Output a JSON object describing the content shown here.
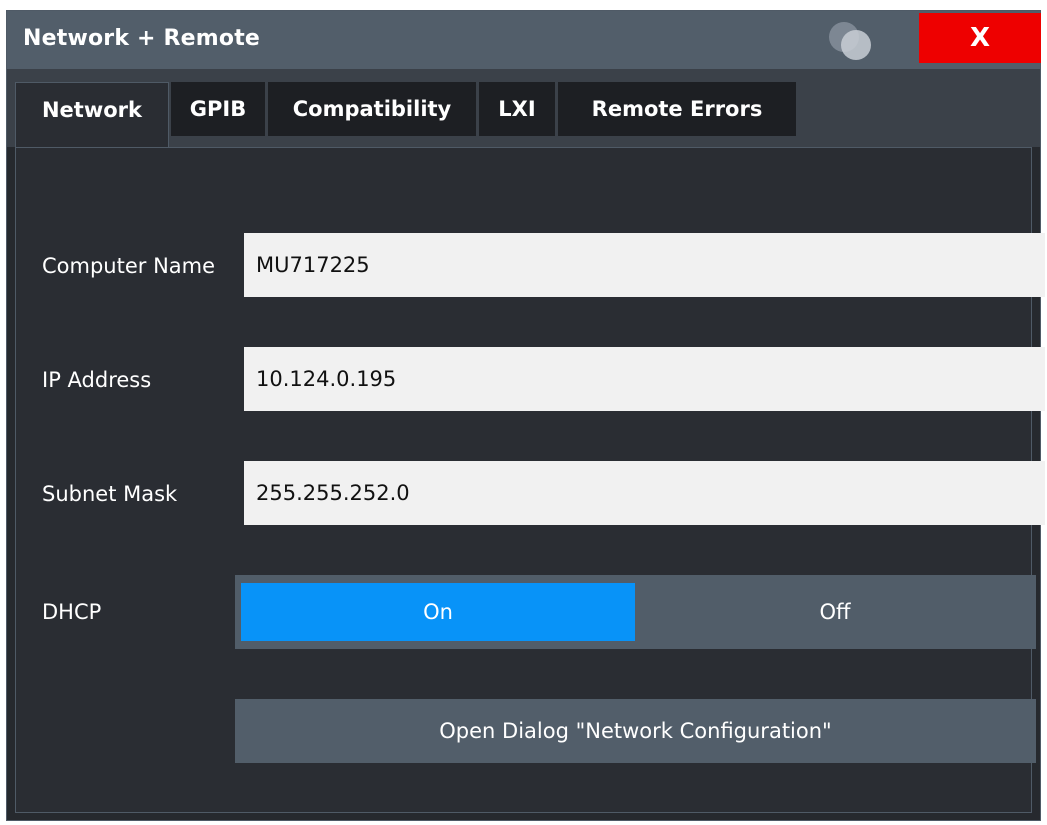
{
  "window": {
    "title": "Network + Remote",
    "close_label": "X"
  },
  "tabs": [
    {
      "label": "Network",
      "active": true
    },
    {
      "label": "GPIB",
      "active": false
    },
    {
      "label": "Compatibility",
      "active": false
    },
    {
      "label": "LXI",
      "active": false
    },
    {
      "label": "Remote Errors",
      "active": false
    }
  ],
  "network": {
    "computer_name": {
      "label": "Computer Name",
      "value": "MU717225"
    },
    "ip_address": {
      "label": "IP Address",
      "value": "10.124.0.195"
    },
    "subnet_mask": {
      "label": "Subnet Mask",
      "value": "255.255.252.0"
    },
    "dhcp": {
      "label": "DHCP",
      "on_label": "On",
      "off_label": "Off",
      "selected": "On"
    },
    "config_button_label": "Open Dialog \"Network Configuration\""
  },
  "colors": {
    "title_bar": "#525e6a",
    "close_button": "#ee0000",
    "toggle_selected": "#0893f8",
    "background": "#26292e"
  },
  "icons": {
    "help": "help-icon",
    "close": "close-icon"
  }
}
